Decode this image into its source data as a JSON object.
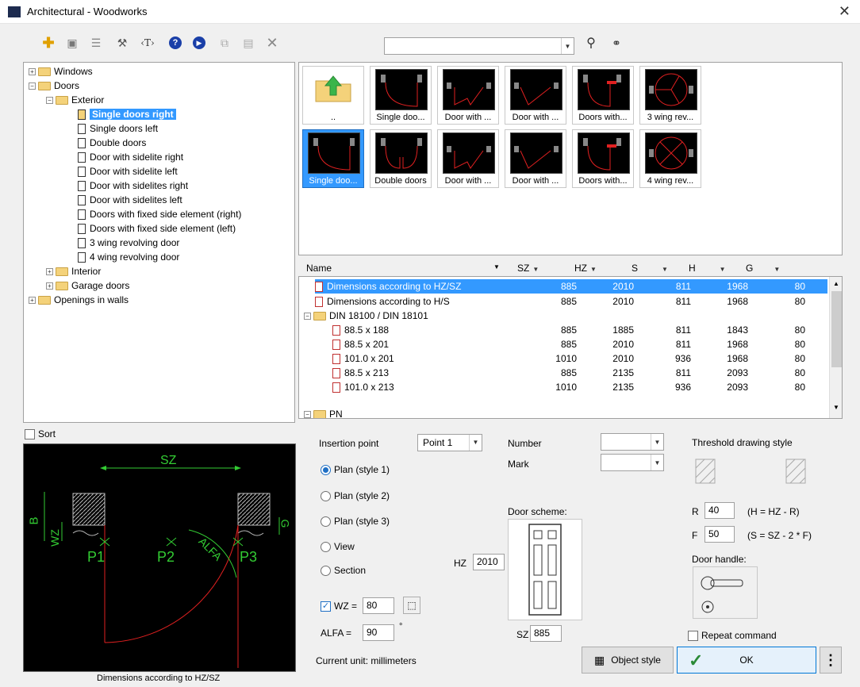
{
  "window": {
    "title": "Architectural - Woodworks"
  },
  "tree": {
    "items": [
      {
        "label": "Windows"
      },
      {
        "label": "Doors"
      },
      {
        "label": "Exterior"
      },
      {
        "label": "Single doors right"
      },
      {
        "label": "Single doors left"
      },
      {
        "label": "Double doors"
      },
      {
        "label": "Door with sidelite right"
      },
      {
        "label": "Door with sidelite left"
      },
      {
        "label": "Door with sidelites right"
      },
      {
        "label": "Door with sidelites left"
      },
      {
        "label": "Doors with fixed side element (right)"
      },
      {
        "label": "Doors with fixed side element (left)"
      },
      {
        "label": "3 wing revolving door"
      },
      {
        "label": "4 wing revolving door"
      },
      {
        "label": "Interior"
      },
      {
        "label": "Garage doors"
      },
      {
        "label": "Openings in walls"
      }
    ]
  },
  "thumbnails": {
    "row1": [
      "..",
      "Single doo...",
      "Door with ...",
      "Door with ...",
      "Doors with...",
      "3 wing rev..."
    ],
    "row2": [
      "Single doo...",
      "Double doors",
      "Door with ...",
      "Door with ...",
      "Doors with...",
      "4 wing rev..."
    ]
  },
  "table": {
    "columns": [
      "Name",
      "SZ",
      "HZ",
      "S",
      "H",
      "G"
    ],
    "rows": [
      {
        "name": "Dimensions according to HZ/SZ",
        "sz": "885",
        "hz": "2010",
        "s": "811",
        "h": "1968",
        "g": "80"
      },
      {
        "name": "Dimensions according to H/S",
        "sz": "885",
        "hz": "2010",
        "s": "811",
        "h": "1968",
        "g": "80"
      },
      {
        "name": "DIN 18100 / DIN 18101",
        "sz": "",
        "hz": "",
        "s": "",
        "h": "",
        "g": ""
      },
      {
        "name": "88.5 x 188",
        "sz": "885",
        "hz": "1885",
        "s": "811",
        "h": "1843",
        "g": "80"
      },
      {
        "name": "88.5 x 201",
        "sz": "885",
        "hz": "2010",
        "s": "811",
        "h": "1968",
        "g": "80"
      },
      {
        "name": "101.0 x 201",
        "sz": "1010",
        "hz": "2010",
        "s": "936",
        "h": "1968",
        "g": "80"
      },
      {
        "name": "88.5 x 213",
        "sz": "885",
        "hz": "2135",
        "s": "811",
        "h": "2093",
        "g": "80"
      },
      {
        "name": "101.0 x 213",
        "sz": "1010",
        "hz": "2135",
        "s": "936",
        "h": "2093",
        "g": "80"
      },
      {
        "name": "PN",
        "sz": "",
        "hz": "",
        "s": "",
        "h": "",
        "g": ""
      }
    ]
  },
  "preview": {
    "sort_label": "Sort",
    "labels": {
      "sz": "SZ",
      "b": "B",
      "wz": "WZ",
      "g": "G",
      "p1": "P1",
      "p2": "P2",
      "p3": "P3",
      "alfa": "ALFA"
    },
    "caption": "Dimensions according to HZ/SZ"
  },
  "options": {
    "insertion_point_label": "Insertion point",
    "insertion_point_value": "Point 1",
    "radios": [
      "Plan (style 1)",
      "Plan (style 2)",
      "Plan (style 3)",
      "View",
      "Section"
    ],
    "wz_label": "WZ =",
    "wz_value": "80",
    "alfa_label": "ALFA =",
    "alfa_value": "90",
    "degree": "°",
    "current_unit": "Current unit: millimeters"
  },
  "number": {
    "number_label": "Number",
    "mark_label": "Mark",
    "door_scheme_label": "Door scheme:",
    "hz_label": "HZ",
    "hz_value": "2010",
    "sz_label": "SZ",
    "sz_value": "885"
  },
  "threshold": {
    "title": "Threshold drawing style",
    "r_label": "R",
    "r_value": "40",
    "r_formula": "(H = HZ - R)",
    "f_label": "F",
    "f_value": "50",
    "f_formula": "(S = SZ - 2 * F)",
    "door_handle_label": "Door handle:",
    "repeat_label": "Repeat command"
  },
  "buttons": {
    "object_style": "Object style",
    "ok": "OK",
    "more": "⋮"
  },
  "colors": {
    "selection": "#3399ff",
    "drawing_bg": "#000000",
    "door_red": "#e02020",
    "dim_green": "#33cc33"
  }
}
